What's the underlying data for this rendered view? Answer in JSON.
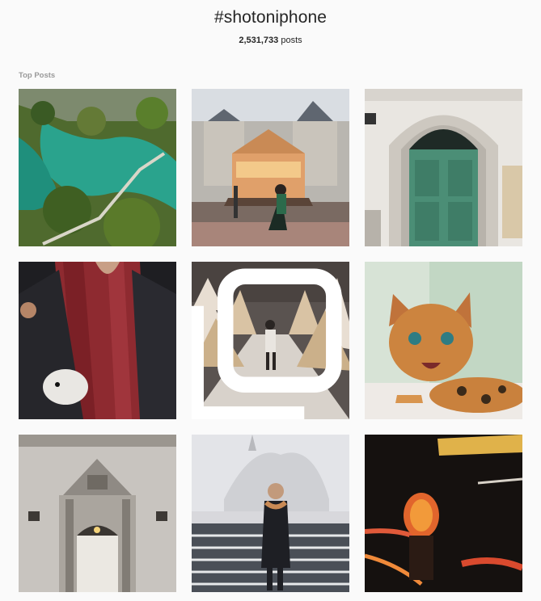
{
  "page": {
    "hashtag": "#shotoniphone",
    "post_count": "2,531,733",
    "post_count_suffix": " posts",
    "section_title": "Top Posts"
  },
  "grid": {
    "posts": [
      {
        "subject": "aerial lake with wooden boardwalk",
        "icon": "none"
      },
      {
        "subject": "carousel in front of city hall",
        "icon": "none"
      },
      {
        "subject": "green wooden door",
        "icon": "none"
      },
      {
        "subject": "hedgehog in jacket pocket",
        "icon": "none"
      },
      {
        "subject": "snowy christmas tree alley",
        "icon": "multiple-posts-icon"
      },
      {
        "subject": "bengal cat",
        "icon": "none"
      },
      {
        "subject": "ornate building entrance",
        "icon": "none"
      },
      {
        "subject": "woman on snowy stairs",
        "icon": "none"
      },
      {
        "subject": "night light trails",
        "icon": "none"
      }
    ]
  },
  "colors": {
    "background": "#fafafa",
    "text": "#262626",
    "label_grey": "#999999"
  }
}
